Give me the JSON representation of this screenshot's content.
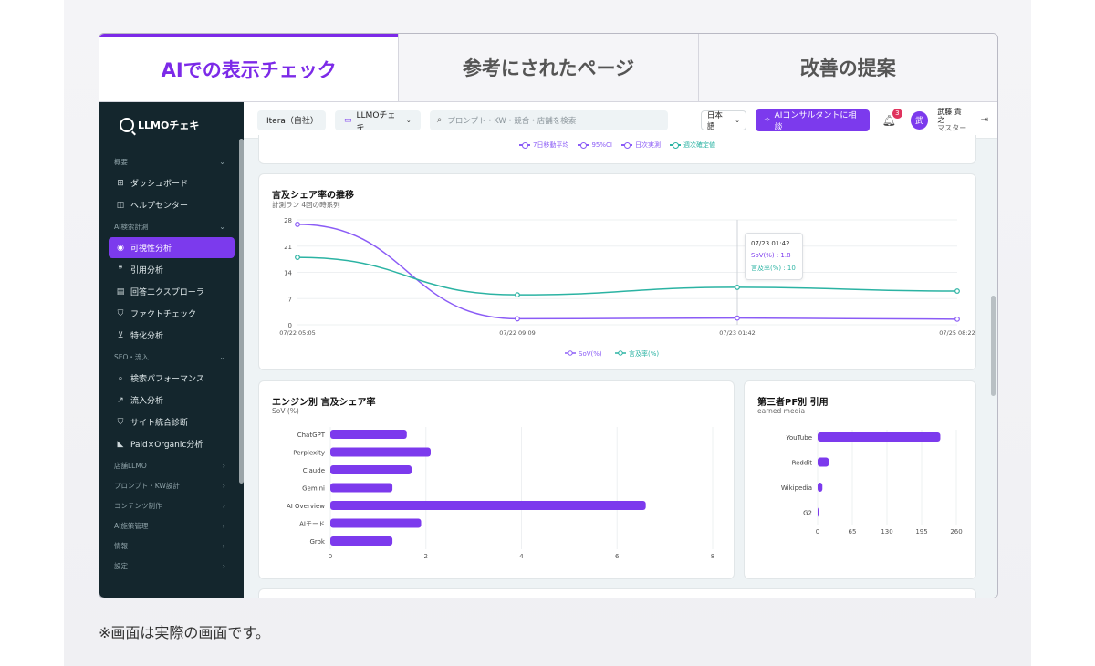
{
  "tabs": [
    {
      "label": "AIでの表示チェック",
      "active": true
    },
    {
      "label": "参考にされたページ",
      "active": false
    },
    {
      "label": "改善の提案",
      "active": false
    }
  ],
  "caption": "※画面は実際の画面です。",
  "sidebar": {
    "logo": "LLMOチェキ",
    "sections": [
      {
        "label": "概要",
        "items": [
          {
            "icon": "dashboard-icon",
            "label": "ダッシュボード"
          },
          {
            "icon": "book-icon",
            "label": "ヘルプセンター"
          }
        ]
      },
      {
        "label": "AI検索計測",
        "items": [
          {
            "icon": "eye-icon",
            "label": "可視性分析",
            "active": true
          },
          {
            "icon": "quote-icon",
            "label": "引用分析"
          },
          {
            "icon": "explorer-icon",
            "label": "回答エクスプローラ"
          },
          {
            "icon": "shield-check-icon",
            "label": "ファクトチェック"
          },
          {
            "icon": "cart-icon",
            "label": "特化分析"
          }
        ]
      },
      {
        "label": "SEO・流入",
        "items": [
          {
            "icon": "search-icon",
            "label": "検索パフォーマンス"
          },
          {
            "icon": "trend-icon",
            "label": "流入分析"
          },
          {
            "icon": "shield-icon",
            "label": "サイト統合診断"
          },
          {
            "icon": "megaphone-icon",
            "label": "Paid×Organic分析"
          }
        ]
      },
      {
        "label": "店舗LLMO",
        "items": []
      },
      {
        "label": "プロンプト・KW設計",
        "items": []
      },
      {
        "label": "コンテンツ制作",
        "items": []
      },
      {
        "label": "AI施策管理",
        "items": []
      },
      {
        "label": "情報",
        "items": []
      },
      {
        "label": "設定",
        "items": []
      }
    ]
  },
  "topbar": {
    "org": "Itera（自社）",
    "brand": "LLMOチェキ",
    "search_placeholder": "プロンプト・KW・競合・店舗を検索",
    "lang": "日本語",
    "cta": "AIコンサルタントに相談",
    "notification_count": "3",
    "avatar_initial": "武",
    "user_name": "武藤 貴之",
    "user_role": "マスター"
  },
  "top_legend": [
    {
      "label": "7日移動平均",
      "color": "#8b5cf6"
    },
    {
      "label": "95%CI",
      "color": "#8b5cf6"
    },
    {
      "label": "日次実測",
      "color": "#8b5cf6"
    },
    {
      "label": "週次確定値",
      "color": "#2bb3a3"
    }
  ],
  "colors": {
    "purple": "#7c3aed",
    "teal": "#2bb3a3"
  },
  "chart_data": [
    {
      "type": "line",
      "title": "言及シェア率の推移",
      "subtitle": "計測ラン 4回の時系列",
      "x": [
        "07/22 05:05",
        "07/22 09:09",
        "07/23 01:42",
        "07/25 08:22"
      ],
      "ylim": [
        0,
        28
      ],
      "yticks": [
        0,
        7,
        14,
        21,
        28
      ],
      "series": [
        {
          "name": "SoV(%)",
          "color": "#8b5cf6",
          "values": [
            26.8,
            1.6,
            1.8,
            1.5
          ]
        },
        {
          "name": "言及率(%)",
          "color": "#2bb3a3",
          "values": [
            18,
            8,
            10,
            9
          ]
        }
      ],
      "tooltip": {
        "date": "07/23 01:42",
        "lines": [
          "SoV(%) : 1.8",
          "言及率(%) : 10"
        ]
      }
    },
    {
      "type": "bar",
      "orientation": "horizontal",
      "title": "エンジン別 言及シェア率",
      "subtitle": "SoV (%)",
      "categories": [
        "ChatGPT",
        "Perplexity",
        "Claude",
        "Gemini",
        "AI Overview",
        "AIモード",
        "Grok"
      ],
      "values": [
        1.6,
        2.1,
        1.7,
        1.3,
        6.6,
        1.9,
        1.3
      ],
      "xlim": [
        0,
        8
      ],
      "xticks": [
        0,
        2,
        4,
        6,
        8
      ],
      "color": "#7c3aed"
    },
    {
      "type": "bar",
      "orientation": "horizontal",
      "title": "第三者PF別 引用",
      "subtitle": "earned media",
      "categories": [
        "YouTube",
        "Reddit",
        "Wikipedia",
        "G2"
      ],
      "values": [
        230,
        21,
        9,
        1
      ],
      "xlim": [
        0,
        260
      ],
      "xticks": [
        0,
        65,
        130,
        195,
        260
      ],
      "color": "#7c3aed"
    }
  ]
}
